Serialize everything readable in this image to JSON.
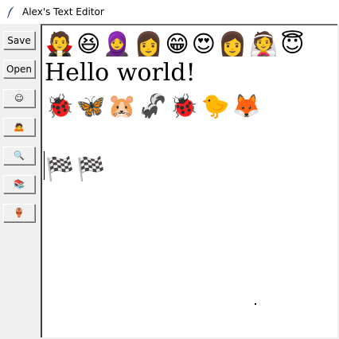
{
  "window": {
    "title": "Alex's Text Editor",
    "icon": "feather-icon"
  },
  "toolbar": {
    "save_label": "Save",
    "open_label": "Open",
    "buttons": [
      {
        "icon": "smiley-icon",
        "glyph": "☺"
      },
      {
        "icon": "person-icon",
        "glyph": "🙇"
      },
      {
        "icon": "magnifier-icon",
        "glyph": "🔍"
      },
      {
        "icon": "books-icon",
        "glyph": "📚"
      },
      {
        "icon": "potion-icon",
        "glyph": "🏺"
      }
    ]
  },
  "editor": {
    "line1": "🧛😆🧕👩😁😍👩👰😇",
    "line2": "Hello world!",
    "line3": "🐞🦋🐹🦨🐞🐤🦊",
    "line5": "🏁🏁"
  }
}
